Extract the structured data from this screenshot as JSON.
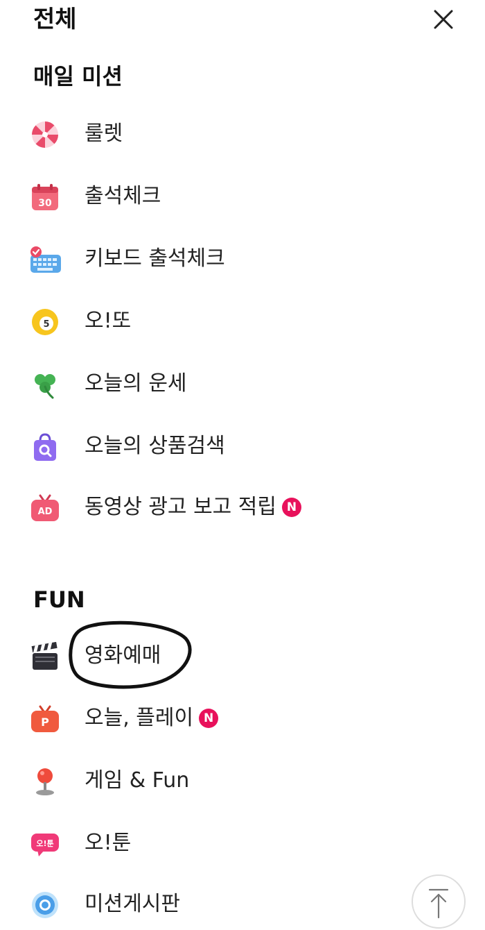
{
  "header": {
    "title": "전체",
    "close_icon": "close-icon"
  },
  "sections": {
    "daily": {
      "title": "매일 미션",
      "items": [
        {
          "label": "룰렛",
          "icon": "roulette-icon"
        },
        {
          "label": "출석체크",
          "icon": "calendar-icon",
          "icon_text": "30"
        },
        {
          "label": "키보드 출석체크",
          "icon": "keyboard-icon"
        },
        {
          "label": "오!또",
          "icon": "lottery-ball-icon",
          "icon_text": "5"
        },
        {
          "label": "오늘의 운세",
          "icon": "clover-icon"
        },
        {
          "label": "오늘의 상품검색",
          "icon": "shopping-bag-search-icon"
        },
        {
          "label": "동영상 광고 보고 적립",
          "icon": "ad-tv-icon",
          "icon_text": "AD",
          "badge": "N"
        }
      ]
    },
    "fun": {
      "title": "FUN",
      "items": [
        {
          "label": "영화예매",
          "icon": "clapperboard-icon"
        },
        {
          "label": "오늘, 플레이",
          "icon": "play-tv-icon",
          "icon_text": "P",
          "badge": "N"
        },
        {
          "label": "게임 & Fun",
          "icon": "joystick-icon"
        },
        {
          "label": "오!툰",
          "icon": "toon-bubble-icon",
          "icon_text": "오!툰"
        },
        {
          "label": "미션게시판",
          "icon": "target-circle-icon"
        }
      ]
    }
  },
  "scroll_top_icon": "arrow-up-to-top-icon",
  "colors": {
    "badge": "#e8115b",
    "text": "#222222",
    "background": "#ffffff"
  }
}
